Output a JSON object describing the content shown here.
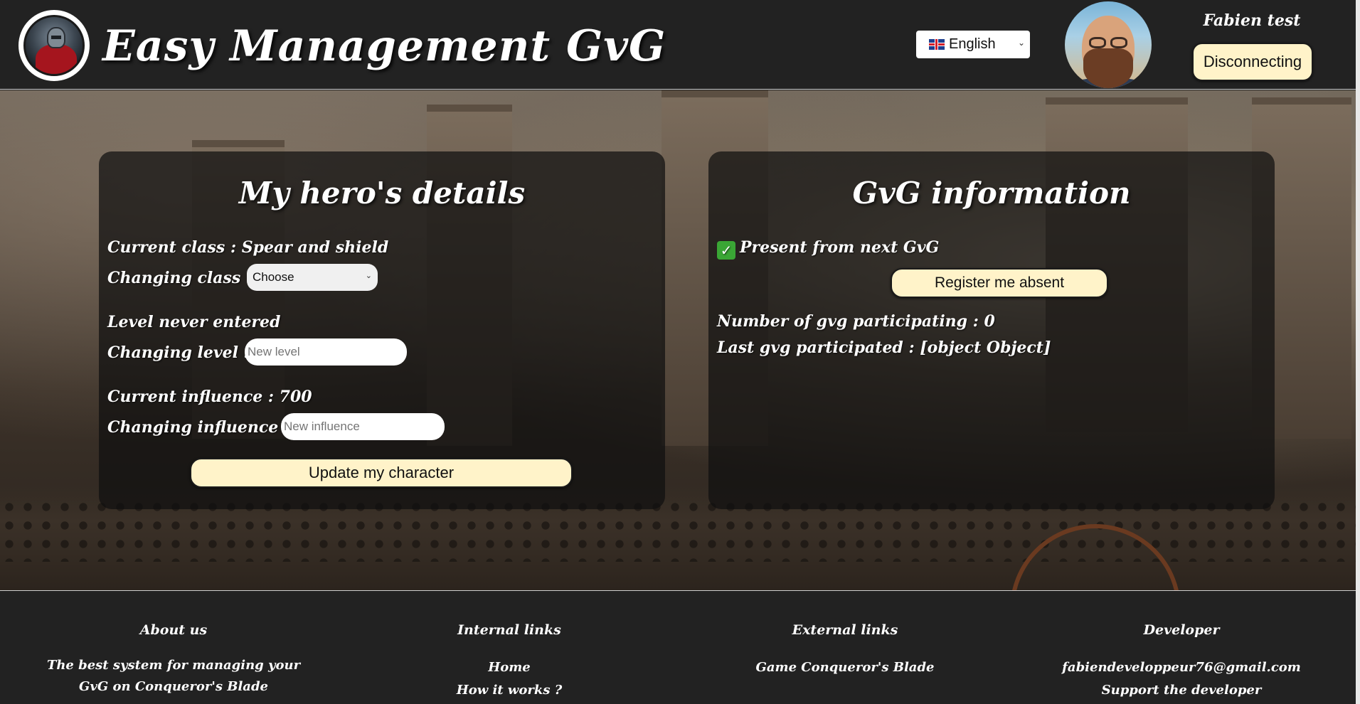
{
  "header": {
    "site_title": "Easy Management GvG",
    "language": "🇬🇧 English",
    "language_label": "English",
    "user_name": "Fabien test",
    "disconnect_label": "Disconnecting"
  },
  "hero_panel": {
    "title": "My hero's details",
    "current_class": "Current class : Spear and shield",
    "changing_class_label": "Changing class :",
    "class_select_value": "Choose",
    "level_status": "Level never entered",
    "changing_level_label": "Changing level :",
    "level_placeholder": "New level",
    "current_influence": "Current influence : 700",
    "changing_influence_label": "Changing influence :",
    "influence_placeholder": "New influence",
    "update_button": "Update my character"
  },
  "gvg_panel": {
    "title": "GvG information",
    "presence_status": "Present from next GvG",
    "absent_button": "Register me absent",
    "participating_count": "Number of gvg participating : 0",
    "last_participated": "Last gvg participated : [object Object]"
  },
  "footer": {
    "about": {
      "title": "About us",
      "text": "The best system for managing your GvG on Conqueror's Blade"
    },
    "internal": {
      "title": "Internal links",
      "links": [
        "Home",
        "How it works ?"
      ]
    },
    "external": {
      "title": "External links",
      "links": [
        "Game Conqueror's Blade"
      ]
    },
    "developer": {
      "title": "Developer",
      "email": "fabiendeveloppeur76@gmail.com",
      "support": "Support the developer"
    }
  },
  "colors": {
    "header_bg": "#222222",
    "button_bg": "#fff3c9",
    "panel_bg": "rgba(15,15,15,0.72)",
    "check_green": "#3aa635"
  }
}
